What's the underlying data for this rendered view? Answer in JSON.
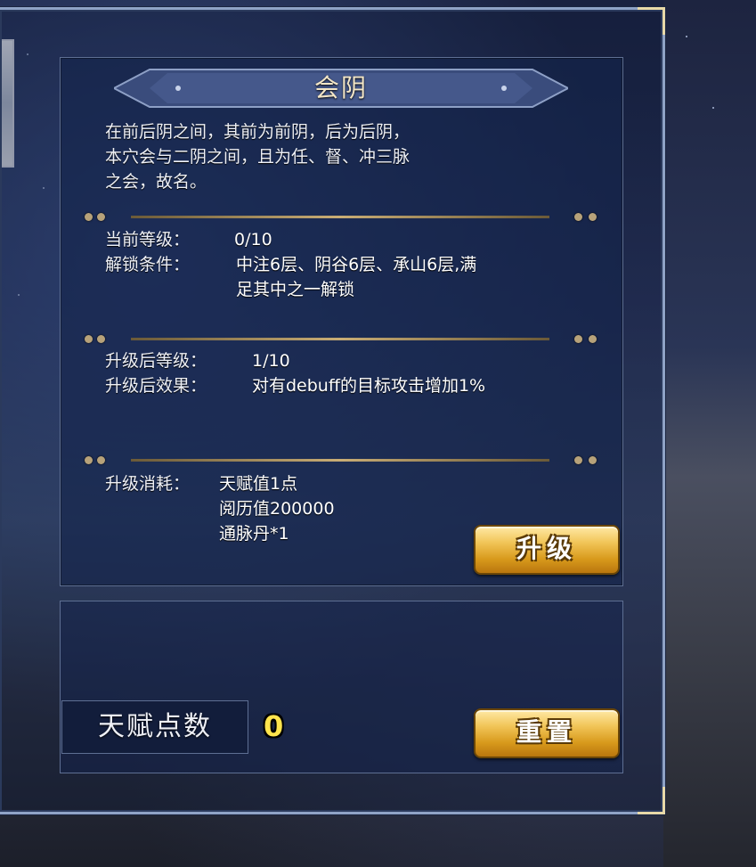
{
  "acupoint": {
    "title": "会阴",
    "description": [
      "在前后阴之间，其前为前阴，后为后阴，",
      "本穴会与二阴之间，且为任、督、冲三脉",
      "之会，故名。"
    ]
  },
  "current": {
    "level_label": "当前等级：",
    "level_value": "0/10",
    "unlock_label": "解锁条件：",
    "unlock_value": [
      "中注6层、阴谷6层、承山6层,满",
      "足其中之一解锁"
    ]
  },
  "upgrade": {
    "level_label": "升级后等级：",
    "level_value": "1/10",
    "effect_label": "升级后效果：",
    "effect_value": "对有debuff的目标攻击增加1%"
  },
  "cost": {
    "label": "升级消耗：",
    "items": [
      "天赋值1点",
      "阅历值200000",
      "通脉丹*1"
    ]
  },
  "buttons": {
    "upgrade": "升级",
    "reset": "重置"
  },
  "talent": {
    "label": "天赋点数",
    "value": "0"
  },
  "colors": {
    "gold_button": "#f1c457",
    "talent_value": "#ffe44d",
    "divider": "#c9ad75"
  }
}
